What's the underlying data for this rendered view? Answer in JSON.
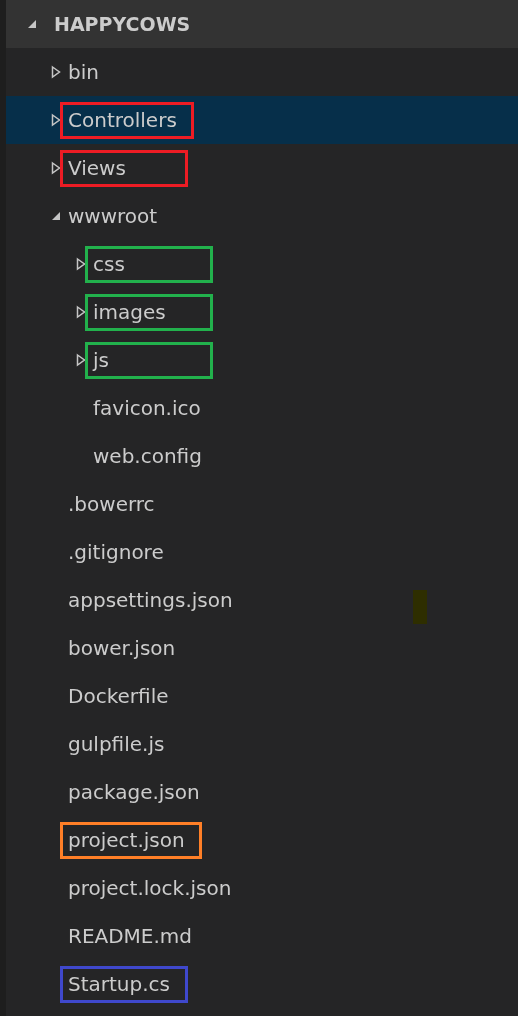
{
  "explorer": {
    "title": "HAPPYCOWS",
    "expanded": true,
    "items": [
      {
        "kind": "folder",
        "name": "bin",
        "expanded": false,
        "selected": false
      },
      {
        "kind": "folder",
        "name": "Controllers",
        "expanded": false,
        "selected": true,
        "color": "#ed1c24"
      },
      {
        "kind": "folder",
        "name": "Views",
        "expanded": false,
        "selected": false,
        "color": "#ed1c24"
      },
      {
        "kind": "folder",
        "name": "wwwroot",
        "expanded": true,
        "selected": false,
        "children": [
          {
            "kind": "folder",
            "name": "css",
            "expanded": false,
            "selected": false,
            "color": "#22b14c"
          },
          {
            "kind": "folder",
            "name": "images",
            "expanded": false,
            "selected": false,
            "color": "#22b14c"
          },
          {
            "kind": "folder",
            "name": "js",
            "expanded": false,
            "selected": false,
            "color": "#22b14c"
          },
          {
            "kind": "file",
            "name": "favicon.ico",
            "selected": false
          },
          {
            "kind": "file",
            "name": "web.config",
            "selected": false
          }
        ]
      },
      {
        "kind": "file",
        "name": ".bowerrc",
        "selected": false
      },
      {
        "kind": "file",
        "name": ".gitignore",
        "selected": false
      },
      {
        "kind": "file",
        "name": "appsettings.json",
        "selected": false
      },
      {
        "kind": "file",
        "name": "bower.json",
        "selected": false
      },
      {
        "kind": "file",
        "name": "Dockerfile",
        "selected": false
      },
      {
        "kind": "file",
        "name": "gulpfile.js",
        "selected": false
      },
      {
        "kind": "file",
        "name": "package.json",
        "selected": false
      },
      {
        "kind": "file",
        "name": "project.json",
        "selected": false,
        "color": "#ff7f27"
      },
      {
        "kind": "file",
        "name": "project.lock.json",
        "selected": false
      },
      {
        "kind": "file",
        "name": "README.md",
        "selected": false
      },
      {
        "kind": "file",
        "name": "Startup.cs",
        "selected": false,
        "color": "#3f48cc"
      }
    ]
  }
}
